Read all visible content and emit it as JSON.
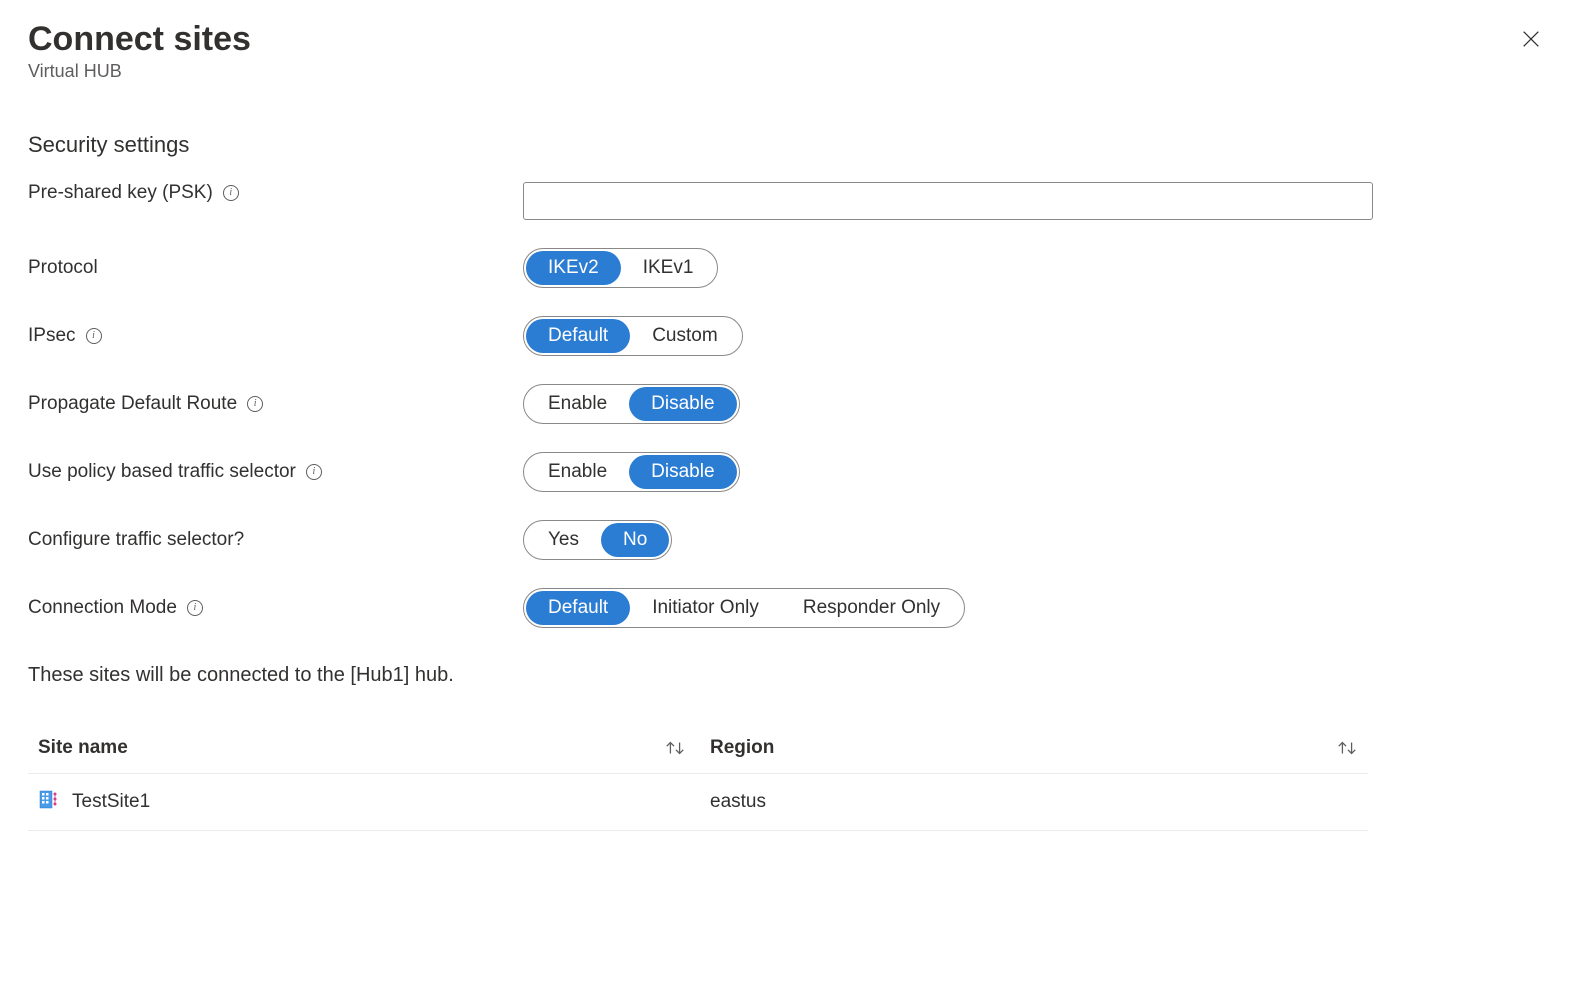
{
  "header": {
    "title": "Connect sites",
    "subtitle": "Virtual HUB"
  },
  "security": {
    "heading": "Security settings",
    "psk_label": "Pre-shared key (PSK)",
    "psk_value": "",
    "protocol_label": "Protocol",
    "protocol_options": {
      "a": "IKEv2",
      "b": "IKEv1"
    },
    "ipsec_label": "IPsec",
    "ipsec_options": {
      "a": "Default",
      "b": "Custom"
    },
    "default_route_label": "Propagate Default Route",
    "default_route_options": {
      "a": "Enable",
      "b": "Disable"
    },
    "policy_selector_label": "Use policy based traffic selector",
    "policy_selector_options": {
      "a": "Enable",
      "b": "Disable"
    },
    "configure_ts_label": "Configure traffic selector?",
    "configure_ts_options": {
      "a": "Yes",
      "b": "No"
    },
    "connection_mode_label": "Connection Mode",
    "connection_mode_options": {
      "a": "Default",
      "b": "Initiator Only",
      "c": "Responder Only"
    }
  },
  "sites_note": "These sites will be connected to the [Hub1] hub.",
  "table": {
    "col_site": "Site name",
    "col_region": "Region",
    "rows": [
      {
        "site": "TestSite1",
        "region": "eastus"
      }
    ]
  }
}
